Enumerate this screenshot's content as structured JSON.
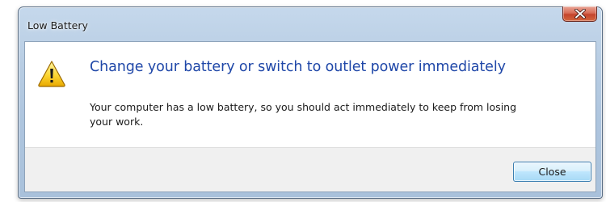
{
  "window": {
    "title": "Low Battery"
  },
  "titlebar": {
    "close_icon": "close-icon"
  },
  "message": {
    "icon": "warning-icon",
    "heading": "Change your battery or switch to outlet power immediately",
    "body": "Your computer has a low battery, so you should act immediately to keep from losing your work."
  },
  "footer": {
    "close_label": "Close"
  },
  "colors": {
    "heading": "#1f47a8",
    "frame": "#b8cde3",
    "close_button_red": "#c4442c",
    "footer_bg": "#f0f0f0"
  }
}
